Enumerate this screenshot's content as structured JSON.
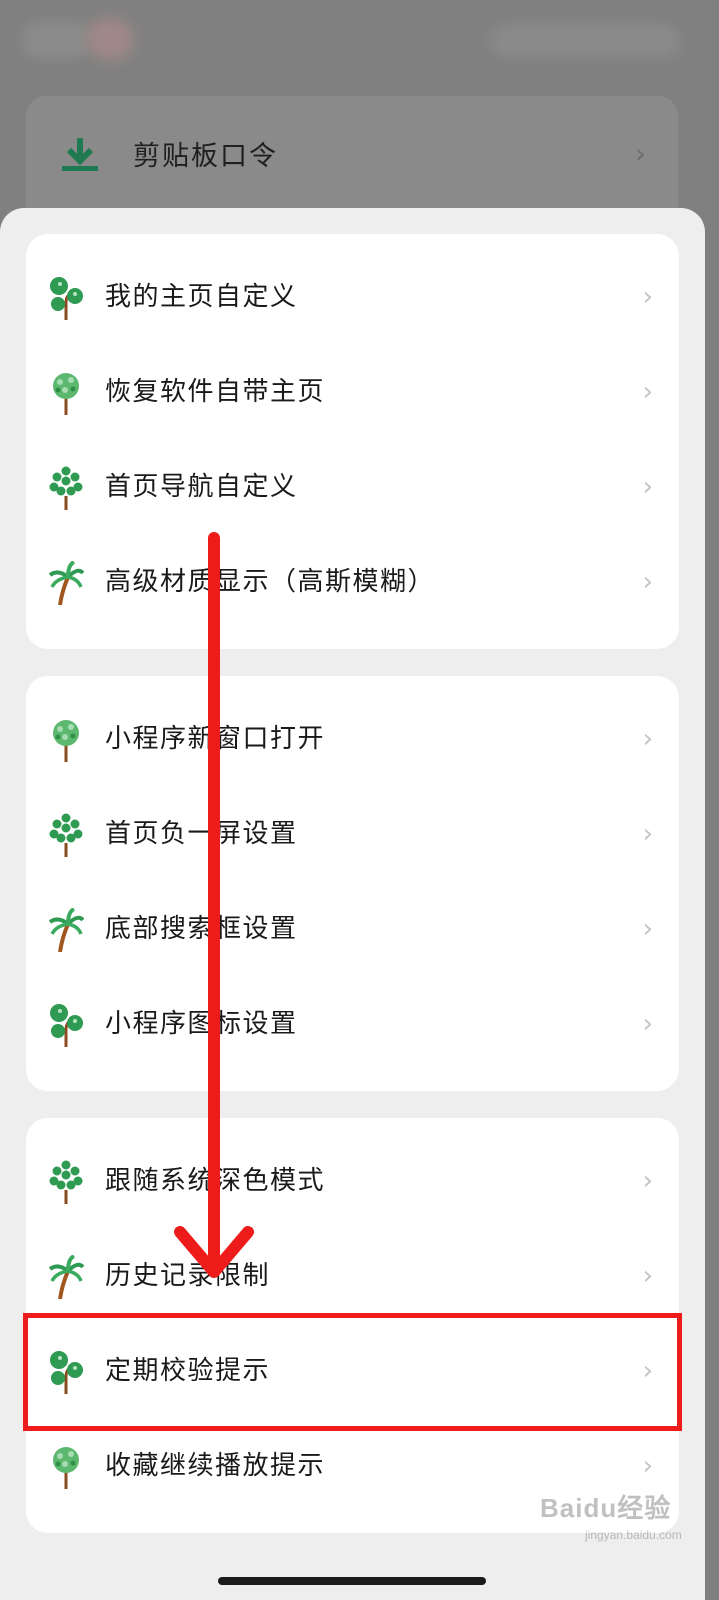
{
  "background": {
    "clipboard_row_label": "剪贴板口令",
    "clipboard_icon": "download-icon",
    "chevron": "›"
  },
  "groups": [
    {
      "items": [
        {
          "label": "我的主页自定义",
          "icon": "tree-round-icon"
        },
        {
          "label": "恢复软件自带主页",
          "icon": "tree-bushy-icon"
        },
        {
          "label": "首页导航自定义",
          "icon": "tree-dotted-icon"
        },
        {
          "label": "高级材质显示（高斯模糊）",
          "icon": "palm-tree-icon"
        }
      ]
    },
    {
      "items": [
        {
          "label": "小程序新窗口打开",
          "icon": "tree-bushy-icon"
        },
        {
          "label": "首页负一屏设置",
          "icon": "tree-dotted-icon"
        },
        {
          "label": "底部搜索框设置",
          "icon": "palm-tree-icon"
        },
        {
          "label": "小程序图标设置",
          "icon": "tree-round-icon"
        }
      ]
    },
    {
      "items": [
        {
          "label": "跟随系统深色模式",
          "icon": "tree-dotted-icon"
        },
        {
          "label": "历史记录限制",
          "icon": "palm-tree-icon"
        },
        {
          "label": "定期校验提示",
          "icon": "tree-round-icon"
        },
        {
          "label": "收藏继续播放提示",
          "icon": "tree-bushy-icon"
        }
      ]
    }
  ],
  "chevron": "›",
  "annotation": {
    "highlighted_item": "定期校验提示",
    "arrow_color": "#ee1b1b"
  },
  "watermark": "Baidu经验",
  "watermark_sub": "jingyan.baidu.com",
  "colors": {
    "icon_green": "#2e9a52",
    "icon_trunk": "#8a4b1e",
    "sheet_bg": "#eeeeee",
    "card_bg": "#ffffff"
  }
}
